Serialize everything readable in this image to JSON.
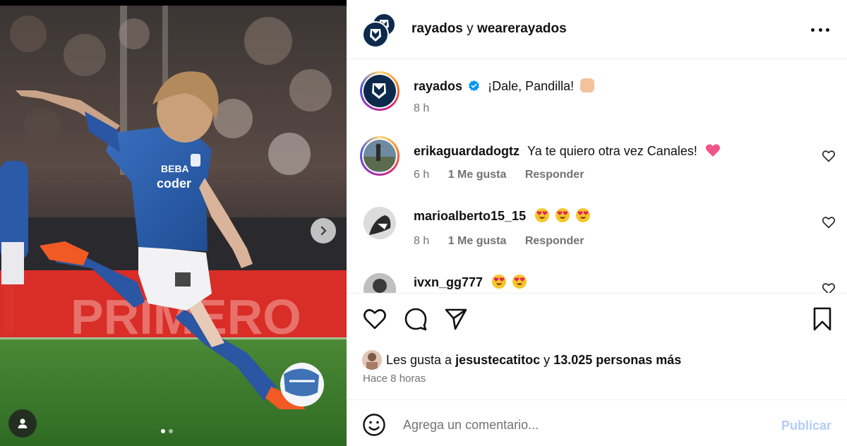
{
  "header": {
    "account_primary": "rayados",
    "joiner": "y",
    "account_secondary": "wearerayados",
    "more_icon": "more-horizontal-icon"
  },
  "caption": {
    "username": "rayados",
    "verified_icon": "verified-badge-icon",
    "text": "¡Dale, Pandilla!",
    "time": "8 h"
  },
  "comments": [
    {
      "username": "erikaguardadogtz",
      "text": "Ya te quiero otra vez Canales!",
      "emoji": "pink-heart",
      "time": "6 h",
      "likes": "1 Me gusta",
      "reply": "Responder"
    },
    {
      "username": "marioalberto15_15",
      "text": "",
      "emoji": "heart-eyes x3",
      "time": "8 h",
      "likes": "1 Me gusta",
      "reply": "Responder"
    },
    {
      "username": "ivxn_gg777",
      "text": "",
      "emoji": "heart-eyes x2"
    }
  ],
  "likes_summary": {
    "prefix": "Les gusta a",
    "user": "jesustecatitoc",
    "joiner": "y",
    "others": "13.025 personas más"
  },
  "posted_time": "Hace 8 horas",
  "composer": {
    "placeholder": "Agrega un comentario...",
    "publish_label": "Publicar"
  },
  "carousel": {
    "current": 1,
    "total": 2
  },
  "colors": {
    "accent_blue": "#0095f6",
    "publish_disabled": "#b3cdf7",
    "secondary_text": "#737373",
    "kit_blue": "#2d5fae"
  }
}
